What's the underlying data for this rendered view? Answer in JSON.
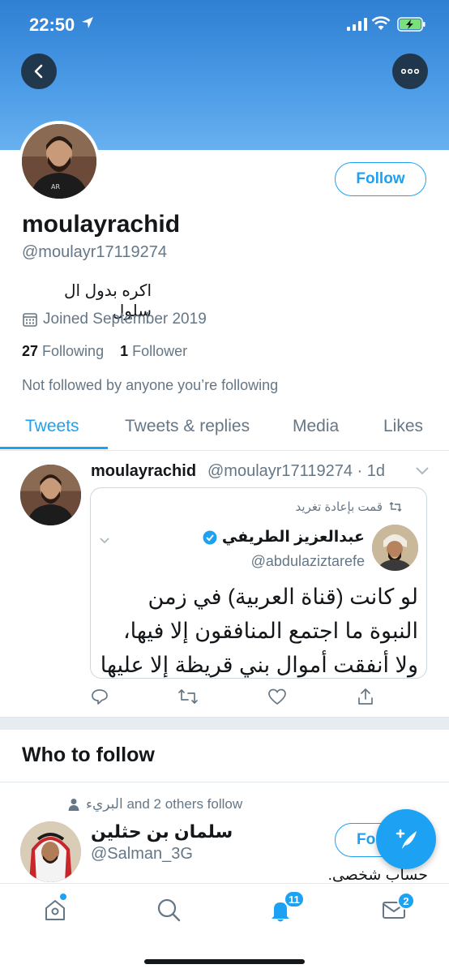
{
  "status_bar": {
    "time": "22:50"
  },
  "profile": {
    "display_name": "moulayrachid",
    "handle": "@moulayr17119274",
    "bio": "اكره بدول ال سلول",
    "joined": "Joined September 2019",
    "following_count": "27",
    "following_label": "Following",
    "followers_count": "1",
    "followers_label": "Follower",
    "not_followed_text": "Not followed by anyone you’re following",
    "follow_label": "Follow"
  },
  "tabs": [
    {
      "label": "Tweets",
      "active": true
    },
    {
      "label": "Tweets & replies",
      "active": false
    },
    {
      "label": "Media",
      "active": false
    },
    {
      "label": "Likes",
      "active": false
    }
  ],
  "tweet": {
    "name": "moulayrachid",
    "handle_time": "@moulayr17119274 · 1d",
    "quote": {
      "retweet_context": "قمت بإعادة تغريد",
      "name": "عبدالعزيز الطريفي",
      "handle": "@abdulaziztarefe",
      "text": "لو كانت (قناة العربية) في زمن النبوة ما اجتمع المنافقون إلا فيها، ولا أنفقت أموال بني قريظة إلا عليها ."
    }
  },
  "who_to_follow": {
    "title": "Who to follow",
    "social_context": "البريء and 2 others follow",
    "user": {
      "name": "سلمان بن حثلين",
      "handle": "@Salman_3G",
      "follow_label": "Fo",
      "bio": "حساب شخصي."
    }
  },
  "bottom_nav": {
    "notifications_badge": "11",
    "messages_badge": "2"
  },
  "colors": {
    "accent": "#1da1f2",
    "secondary_text": "#657786"
  }
}
